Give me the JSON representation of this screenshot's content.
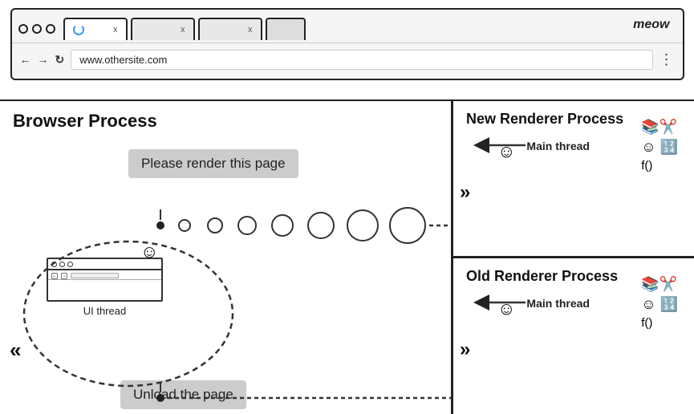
{
  "browser": {
    "meow": "meow",
    "tab1": {
      "label": "",
      "loading": true
    },
    "tab2": {
      "label": ""
    },
    "tab3": {
      "label": ""
    },
    "tab4": {
      "label": ""
    },
    "address": "www.othersite.com",
    "nav": {
      "back": "←",
      "forward": "→",
      "refresh": "c",
      "more": "⋮"
    }
  },
  "diagram": {
    "browser_process_title": "Browser Process",
    "new_renderer_title": "New Renderer Process",
    "old_renderer_title": "Old Renderer Process",
    "please_render": "Please render this page",
    "unload_page": "Unload the page",
    "ui_thread_label": "UI thread",
    "main_thread_label1": "Main thread",
    "main_thread_label2": "Main thread",
    "double_chevron": "»"
  }
}
